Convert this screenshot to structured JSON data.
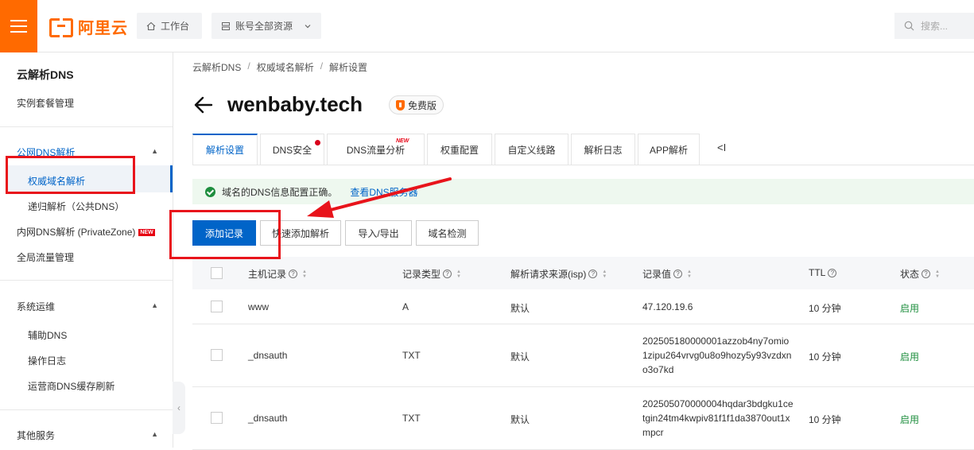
{
  "topbar": {
    "logo_text": "阿里云",
    "workbench": "工作台",
    "resources": "账号全部资源",
    "search_placeholder": "搜索..."
  },
  "sidebar": {
    "title": "云解析DNS",
    "instance_mgmt": "实例套餐管理",
    "public_dns": "公网DNS解析",
    "authoritative": "权威域名解析",
    "recursive": "递归解析（公共DNS）",
    "private_zone": "内网DNS解析 (PrivateZone)",
    "new_badge": "NEW",
    "global_traffic": "全局流量管理",
    "ops": "系统运维",
    "aux_dns": "辅助DNS",
    "op_log": "操作日志",
    "isp_refresh": "运营商DNS缓存刷新",
    "other": "其他服务"
  },
  "breadcrumb": [
    "云解析DNS",
    "权威域名解析",
    "解析设置"
  ],
  "header": {
    "domain": "wenbaby.tech",
    "edition": "免费版"
  },
  "tabs": [
    {
      "label": "解析设置"
    },
    {
      "label": "DNS安全"
    },
    {
      "label": "DNS流量分析"
    },
    {
      "label": "权重配置"
    },
    {
      "label": "自定义线路"
    },
    {
      "label": "解析日志"
    },
    {
      "label": "APP解析"
    }
  ],
  "tab_new_badge": "NEW",
  "tab_more": "<I",
  "notice": {
    "text": "域名的DNS信息配置正确。",
    "link": "查看DNS服务器"
  },
  "actions": {
    "add": "添加记录",
    "quick_add": "快速添加解析",
    "import_export": "导入/导出",
    "check": "域名检测"
  },
  "table": {
    "headers": {
      "host": "主机记录",
      "type": "记录类型",
      "isp": "解析请求来源(isp)",
      "value": "记录值",
      "ttl": "TTL",
      "status": "状态"
    },
    "rows": [
      {
        "host": "www",
        "type": "A",
        "isp": "默认",
        "value": "47.120.19.6",
        "ttl": "10 分钟",
        "status": "启用"
      },
      {
        "host": "_dnsauth",
        "type": "TXT",
        "isp": "默认",
        "value": "202505180000001azzob4ny7omio1zipu264vrvg0u8o9hozy5y93vzdxno3o7kd",
        "ttl": "10 分钟",
        "status": "启用"
      },
      {
        "host": "_dnsauth",
        "type": "TXT",
        "isp": "默认",
        "value": "202505070000004hqdar3bdgku1cetgin24tm4kwpiv81f1f1da3870out1xmpcr",
        "ttl": "10 分钟",
        "status": "启用"
      }
    ]
  },
  "colors": {
    "brand": "#ff6a00",
    "primary": "#0064c8",
    "success": "#1e8e3e",
    "annotation": "#e8141b"
  }
}
